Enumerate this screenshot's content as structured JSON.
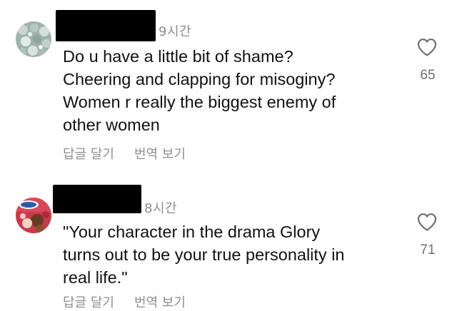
{
  "comments": [
    {
      "time": "9시간",
      "lines": [
        "Do u have a little bit of shame?",
        "Cheering and clapping for misoginy?",
        "Women r really the biggest enemy of",
        "other women"
      ],
      "reply_label": "답글 달기",
      "translate_label": "번역 보기",
      "likes": "65"
    },
    {
      "time": "8시간",
      "lines": [
        "\"Your character in the drama Glory",
        "turns out to be your true personality in",
        "real life.\""
      ],
      "reply_label": "답글 달기",
      "translate_label": "번역 보기",
      "likes": "71"
    }
  ],
  "colors": {
    "text": "#111111",
    "meta": "#8e8e8e",
    "redaction": "#000000"
  },
  "icons": {
    "like": "heart-outline-icon"
  }
}
